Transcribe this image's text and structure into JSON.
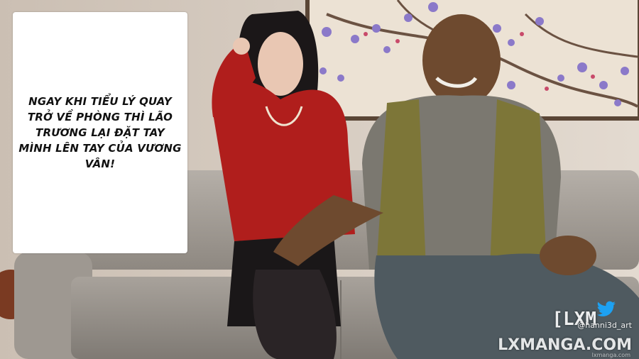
{
  "caption": {
    "text": "Ngay khi Tiểu Lý quay trở về phòng thì Lão Trương lại đặt tay mình lên tay của Vương Vân!"
  },
  "watermark": {
    "bracket": "[LXM",
    "handle": "@hanni3d_art",
    "site": "LXMANGA.COM",
    "small": "lxmanga.com",
    "bird_icon": "twitter-bird-icon",
    "bird_color": "#1da1f2"
  },
  "colors": {
    "wall": "#d9cfc4",
    "sofa": "#a9a39c",
    "dress": "#b01e1c"
  }
}
